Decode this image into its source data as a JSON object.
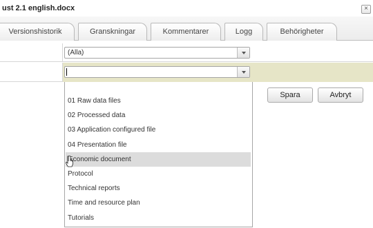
{
  "window": {
    "title": "ust 2.1 english.docx",
    "close_glyph": "×"
  },
  "tabs": [
    {
      "label": "Versionshistorik"
    },
    {
      "label": "Granskningar"
    },
    {
      "label": "Kommentarer"
    },
    {
      "label": "Logg"
    },
    {
      "label": "Behörigheter"
    }
  ],
  "filters": {
    "first_select_value": "(Alla)",
    "second_select_value": ""
  },
  "buttons": {
    "save_label": "Spara",
    "cancel_label": "Avbryt"
  },
  "dropdown": {
    "highlighted_index": 4,
    "items": [
      "",
      "01 Raw data files",
      "02 Processed data",
      "03 Application configured file",
      "04 Presentation file",
      "Economic document",
      "Protocol",
      "Technical reports",
      "Time and resource plan",
      "Tutorials"
    ]
  },
  "icons": {
    "cursor": "hand-pointer-icon",
    "dropdown_arrow": "chevron-down-icon",
    "close": "close-icon"
  }
}
